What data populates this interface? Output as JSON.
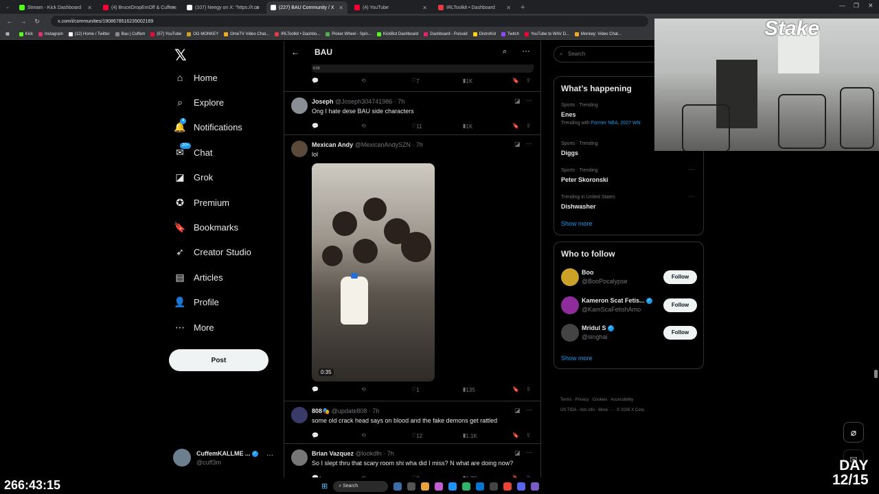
{
  "browser": {
    "tabs": [
      {
        "label": "Stream - Kick Dashboard",
        "color": "#53fc18"
      },
      {
        "label": "(4) BruceDropEmOff & Cuffem",
        "color": "#ff0033"
      },
      {
        "label": "(107) Neegy on X: \"https://t.co",
        "color": "#ffffff"
      },
      {
        "label": "(227) BAU Community / X",
        "color": "#ffffff",
        "active": true
      },
      {
        "label": "(4) YouTube",
        "color": "#ff0033"
      },
      {
        "label": "IRLToolkit • Dashboard",
        "color": "#e63946"
      }
    ],
    "url": "x.com/i/communities/1908678516235002169",
    "bookmarks": [
      {
        "label": "Kick",
        "color": "#53fc18"
      },
      {
        "label": "Instagram",
        "color": "#e1306c"
      },
      {
        "label": "(12) Home / Twitter",
        "color": "#ffffff"
      },
      {
        "label": "Bau | Cuffem",
        "color": "#888888"
      },
      {
        "label": "(57) YouTube",
        "color": "#ff0033"
      },
      {
        "label": "OG MONKEY",
        "color": "#c9a227"
      },
      {
        "label": "OmeTV Video Chat...",
        "color": "#f5a623"
      },
      {
        "label": "IRLToolkit • Dashbo...",
        "color": "#e63946"
      },
      {
        "label": "Picker Wheel - Spin...",
        "color": "#4caf50"
      },
      {
        "label": "KickBot Dashboard",
        "color": "#53fc18"
      },
      {
        "label": "Dashboard - Pulsoid",
        "color": "#e91e63"
      },
      {
        "label": "DistroKid",
        "color": "#ffd600"
      },
      {
        "label": "Twitch",
        "color": "#9146ff"
      },
      {
        "label": "YouTube to WAV D...",
        "color": "#ff0033"
      },
      {
        "label": "Monkey: Video Chat...",
        "color": "#f5a623"
      }
    ]
  },
  "nav": {
    "items": [
      {
        "label": "Home",
        "icon": "home-icon",
        "glyph": "⌂"
      },
      {
        "label": "Explore",
        "icon": "search-icon",
        "glyph": "⌕"
      },
      {
        "label": "Notifications",
        "icon": "bell-icon",
        "glyph": "🔔",
        "badge": "4"
      },
      {
        "label": "Chat",
        "icon": "chat-icon",
        "glyph": "✉",
        "badge": "20+"
      },
      {
        "label": "Grok",
        "icon": "grok-icon",
        "glyph": "◪"
      },
      {
        "label": "Premium",
        "icon": "premium-icon",
        "glyph": "✪"
      },
      {
        "label": "Bookmarks",
        "icon": "bookmark-icon",
        "glyph": "🔖"
      },
      {
        "label": "Creator Studio",
        "icon": "rocket-icon",
        "glyph": "➶"
      },
      {
        "label": "Articles",
        "icon": "article-icon",
        "glyph": "▤"
      },
      {
        "label": "Profile",
        "icon": "person-icon",
        "glyph": "👤"
      },
      {
        "label": "More",
        "icon": "more-circle-icon",
        "glyph": "⋯"
      }
    ],
    "post_label": "Post",
    "account": {
      "name": "CuffemKALLME ...",
      "handle": "@cuff3m"
    }
  },
  "community": {
    "title": "BAU",
    "top_strip_time": "0:15",
    "top_actions": {
      "likes": "7",
      "views": "1K"
    },
    "tweets": [
      {
        "name": "Joseph",
        "handle": "@Joseph304741986 · 7h",
        "text": "Ong I hate dese BAU side characters",
        "likes": "11",
        "views": "1K"
      },
      {
        "name": "Mexican Andy",
        "handle": "@MexicanAndySZN · 7h",
        "text": "lol",
        "duration": "0:35",
        "likes": "1",
        "views": "135"
      },
      {
        "name": "808🎭",
        "handle": "@update808 · 7h",
        "text": "some old crack head says on blood and the fake demons  get rattled",
        "likes": "12",
        "views": "1.1K"
      },
      {
        "name": "Brian Vazquez",
        "handle": "@lookdfn · 7h",
        "text": "So I slept thru that scary room shi wha did I miss? N what are doing now?",
        "replies": "1",
        "likes": "2",
        "views": "1.2K"
      }
    ]
  },
  "right": {
    "search_placeholder": "Search",
    "happening_title": "What’s happening",
    "trends": [
      {
        "meta": "Sports · Trending",
        "name": "Enes",
        "sub_prefix": "Trending with ",
        "sub_link": "Former NBA, 2027 WN"
      },
      {
        "meta": "Sports · Trending",
        "name": "Diggs"
      },
      {
        "meta": "Sports · Trending",
        "name": "Peter Skoronski"
      },
      {
        "meta": "Trending in United States",
        "name": "Dishwasher"
      }
    ],
    "show_more": "Show more",
    "follow_title": "Who to follow",
    "follow": [
      {
        "name": "Boo",
        "handle": "@BooPocalypse",
        "btn": "Follow",
        "color": "#c9a227"
      },
      {
        "name": "Kameron Scat Fetis...",
        "handle": "@KamScaFetishAmo",
        "btn": "Follow",
        "color": "#8e2c9c"
      },
      {
        "name": "Mridul S",
        "handle": "@singhai",
        "btn": "Follow",
        "color": "#444444"
      }
    ],
    "footer": {
      "line1": [
        "Terms",
        "Privacy",
        "Cookies",
        "Accessibility"
      ],
      "line2": [
        "US TIDA",
        "Ads info",
        "More ···",
        "© 2026 X Corp."
      ]
    }
  },
  "overlay": {
    "timer": "266:43:15",
    "day_line1": "DAY",
    "day_line2": "12/15",
    "cam_logo": "Stake",
    "taskbar_search": "Search"
  }
}
